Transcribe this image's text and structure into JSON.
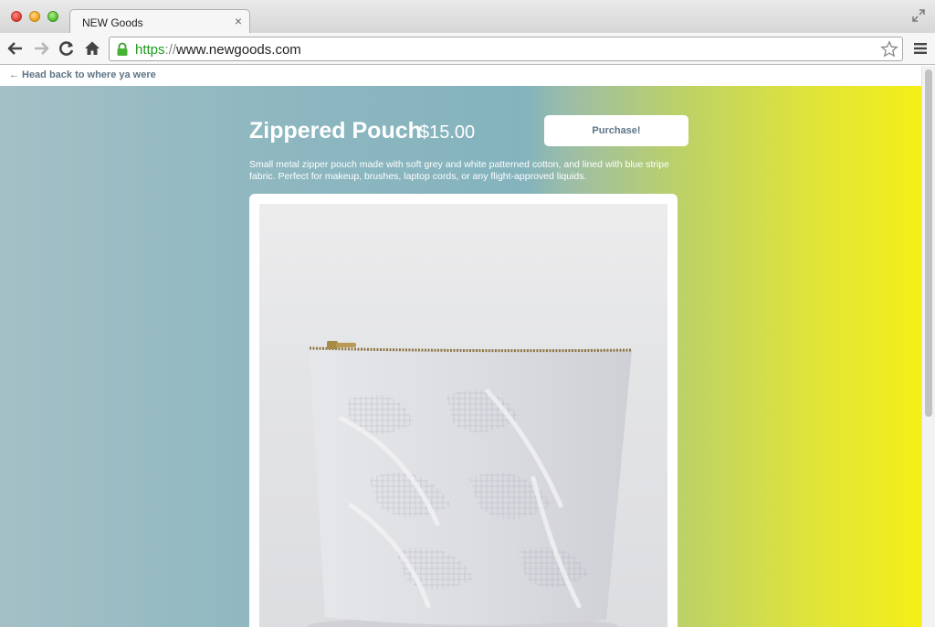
{
  "browser": {
    "tab_title": "NEW Goods",
    "tab_close": "×",
    "url_scheme": "https",
    "url_sep": "://",
    "url_host": "www.newgoods.com"
  },
  "page": {
    "back_link_arrow": "←",
    "back_link_label": "Head back to where ya were",
    "product": {
      "title": "Zippered Pouch",
      "price": "$15.00",
      "purchase_label": "Purchase!",
      "description": "Small metal zipper pouch made with soft grey and white patterned cotton, and lined with blue stripe fabric. Perfect for makeup, brushes, laptop cords, or any flight-approved liquids."
    }
  },
  "colors": {
    "gradient_left": "#a4c0c6",
    "gradient_mid": "#84b3bd",
    "gradient_right": "#f4ef17",
    "link_text": "#5e7486"
  },
  "icons": [
    "back-arrow-icon",
    "forward-arrow-icon",
    "reload-icon",
    "home-icon",
    "lock-icon",
    "star-icon",
    "menu-icon",
    "fullscreen-icon"
  ]
}
